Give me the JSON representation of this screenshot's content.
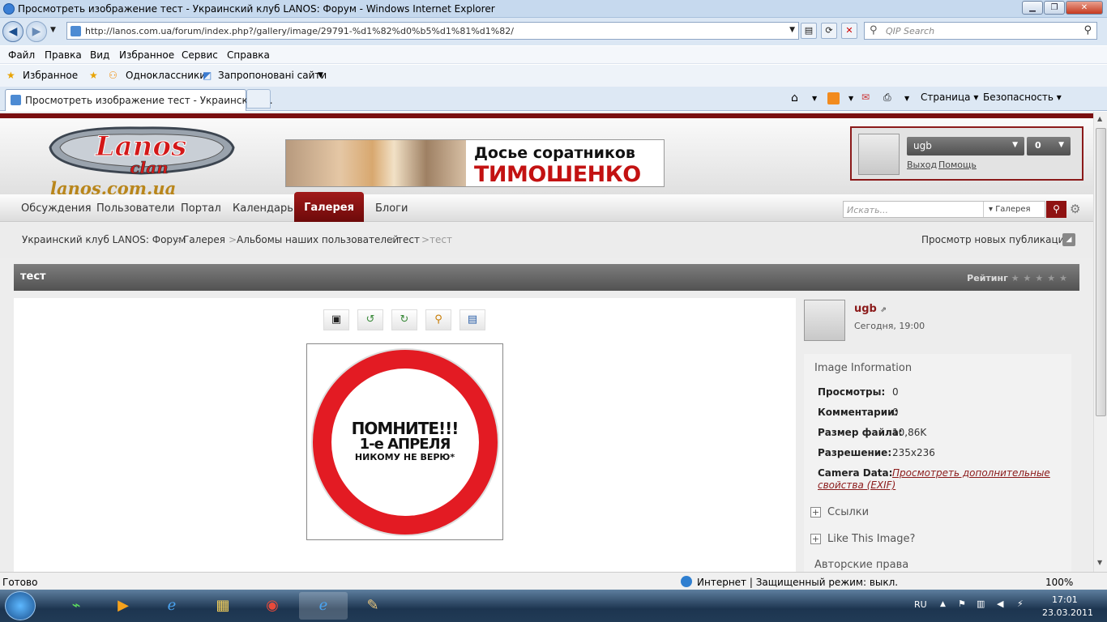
{
  "window": {
    "title": "Просмотреть изображение тест - Украинский клуб LANOS: Форум - Windows Internet Explorer"
  },
  "address": {
    "url": "http://lanos.com.ua/forum/index.php?/gallery/image/29791-%d1%82%d0%b5%d1%81%d1%82/"
  },
  "qip_search": {
    "placeholder": "QIP Search"
  },
  "menu": [
    "Файл",
    "Правка",
    "Вид",
    "Избранное",
    "Сервис",
    "Справка"
  ],
  "favorites": {
    "label": "Избранное",
    "items": [
      "Одноклассники",
      "Запропоновані сайти"
    ]
  },
  "tab": {
    "label": "Просмотреть изображение тест - Украинский ..."
  },
  "commands": {
    "page": "Страница",
    "security": "Безопасность"
  },
  "site": {
    "logo_line1": "Lanos",
    "logo_line2": "clan",
    "logo_url": "lanos.com.ua",
    "banner_line1": "Досье соратников",
    "banner_line2": "ТИМОШЕНКО",
    "user": {
      "name": "ugb",
      "count": "0",
      "logout": "Выход",
      "help": "Помощь"
    },
    "nav": [
      "Обсуждения",
      "Пользователи",
      "Портал",
      "Календарь",
      "Галерея",
      "Блоги"
    ],
    "search": {
      "placeholder": "Искать...",
      "scope": "Галерея"
    },
    "breadcrumb": [
      "Украинский клуб LANOS: Форум",
      "Галерея",
      "Альбомы наших пользователей",
      "тест",
      "тест"
    ],
    "new_posts": "Просмотр новых публикаций",
    "title": "тест",
    "rating_label": "Рейтинг",
    "image_text": {
      "l1": "ПОМНИТЕ!!!",
      "l2": "1-е АПРЕЛЯ",
      "l3": "НИКОМУ НЕ ВЕРЮ*"
    },
    "author": {
      "name": "ugb",
      "date": "Сегодня, 19:00"
    },
    "info": {
      "heading": "Image Information",
      "rows": [
        {
          "label": "Просмотры:",
          "value": "0"
        },
        {
          "label": "Комментарии:",
          "value": "0"
        },
        {
          "label": "Размер файла:",
          "value": "10,86K"
        },
        {
          "label": "Разрешение:",
          "value": "235x236"
        }
      ],
      "camera_label": "Camera Data:",
      "camera_link1": "Просмотреть дополнительные",
      "camera_link2": "свойства (EXIF)",
      "links": "Ссылки",
      "like": "Like This Image?",
      "copyright": "Авторские права"
    }
  },
  "status": {
    "left": "Готово",
    "zone": "Интернет | Защищенный режим: выкл.",
    "zoom": "100%"
  },
  "taskbar": {
    "lang": "RU",
    "time": "17:01",
    "date": "23.03.2011"
  }
}
